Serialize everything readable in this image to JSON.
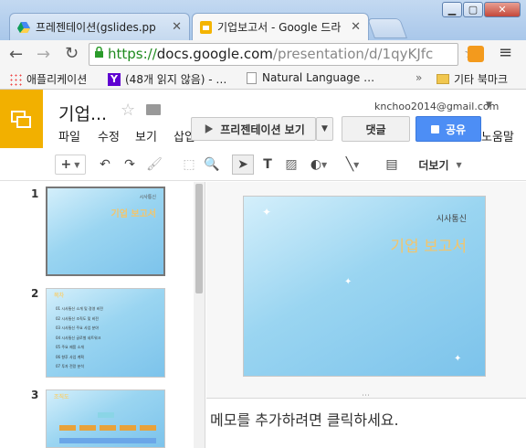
{
  "browser": {
    "tabs": [
      {
        "title": "프레젠테이션(gslides.pp",
        "icon": "google-drive-icon",
        "active": false
      },
      {
        "title": "기업보고서 - Google 드라",
        "icon": "google-slides-icon",
        "active": true
      }
    ],
    "address": {
      "scheme": "https://",
      "host": "docs.google.com",
      "path": "/presentation/d/1qyKJfc"
    },
    "bookmarks": [
      {
        "label": "애플리케이션",
        "icon": "apps-grid-icon"
      },
      {
        "label": "(48개 읽지 않음) - …",
        "icon": "yahoo-icon"
      },
      {
        "label": "Natural Language …",
        "icon": "page-icon"
      }
    ],
    "bookmarks_overflow": "»",
    "other_bookmarks": "기타 북마크"
  },
  "doc": {
    "title": "기업...",
    "account": "knchoo2014@gmail.com",
    "menu": [
      "파일",
      "수정",
      "보기",
      "삽입",
      "...",
      "말"
    ],
    "menu_partial": "노움말",
    "present_label": "프리젠테이션 보기",
    "comments_label": "댓글",
    "share_label": "공유",
    "more_label": "더보기"
  },
  "slides": [
    {
      "number": "1",
      "company": "시사통신",
      "title": "기업 보고서"
    },
    {
      "number": "2",
      "header": "목차",
      "lines": [
        "01 시사통신 소개 및 경영 비전",
        "02 시사통신 조직도 및 비전",
        "03 시사통신 주요 사업 분야",
        "04 시사통신 글로벌 네트워크",
        "05 주요 제품 소개",
        "06 향후 사업 계획",
        "07 투자 전망 분석"
      ]
    },
    {
      "number": "3",
      "header": "조직도"
    }
  ],
  "main_slide": {
    "company": "시사통신",
    "title": "기업 보고서"
  },
  "notes_placeholder": "메모를 추가하려면 클릭하세요."
}
